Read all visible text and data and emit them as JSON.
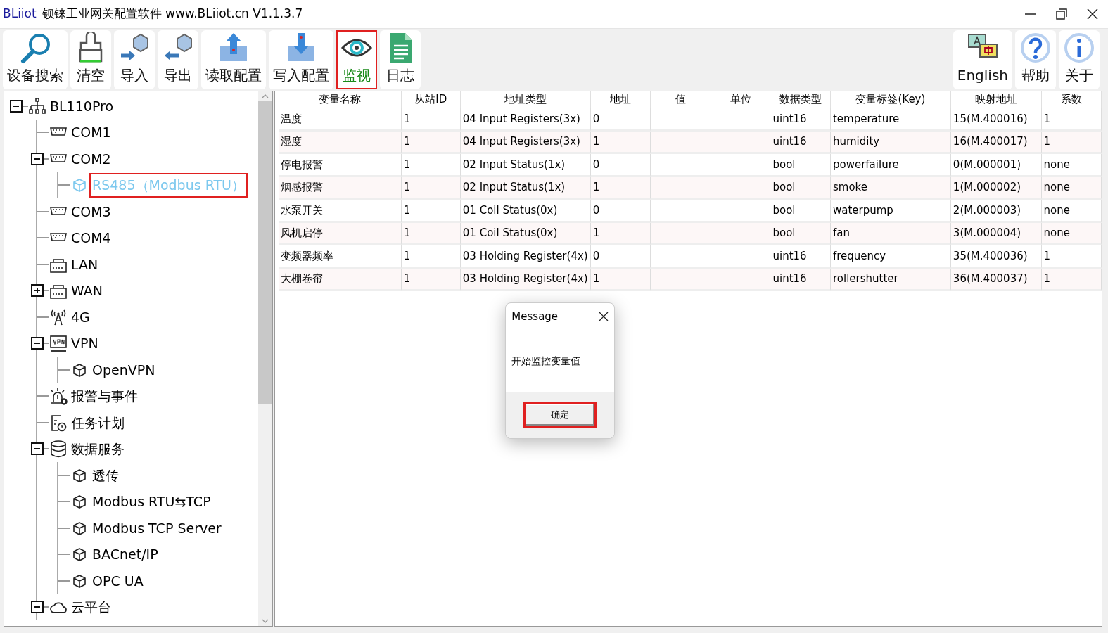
{
  "window": {
    "brand": "BLiiot",
    "title": "钡铼工业网关配置软件 www.BLiiot.cn V1.1.3.7"
  },
  "toolbar": [
    {
      "label": "设备搜索",
      "kind": "search",
      "highlighted": false
    },
    {
      "label": "清空",
      "kind": "brush",
      "highlighted": false
    },
    {
      "label": "导入",
      "kind": "import",
      "highlighted": false
    },
    {
      "label": "导出",
      "kind": "export",
      "highlighted": false
    },
    {
      "label": "读取配置",
      "kind": "read",
      "highlighted": false
    },
    {
      "label": "写入配置",
      "kind": "write",
      "highlighted": false
    },
    {
      "label": "监视",
      "kind": "eye",
      "highlighted": true
    },
    {
      "label": "日志",
      "kind": "log",
      "highlighted": false
    }
  ],
  "toolbar_right": [
    {
      "label": "English",
      "kind": "language"
    },
    {
      "label": "帮助",
      "kind": "help"
    },
    {
      "label": "关于",
      "kind": "about"
    }
  ],
  "tree": [
    {
      "label": "BL110Pro",
      "kind": "network",
      "expanded": true,
      "selected": false,
      "children": [
        {
          "label": "COM1",
          "kind": "serial",
          "selected": false
        },
        {
          "label": "COM2",
          "kind": "serial",
          "expanded": true,
          "selected": false,
          "children": [
            {
              "label": "RS485（Modbus RTU）",
              "kind": "cube",
              "selected": true
            }
          ]
        },
        {
          "label": "COM3",
          "kind": "serial",
          "selected": false
        },
        {
          "label": "COM4",
          "kind": "serial",
          "selected": false
        },
        {
          "label": "LAN",
          "kind": "ethernet",
          "selected": false
        },
        {
          "label": "WAN",
          "kind": "ethernet",
          "expanded": false,
          "selected": false
        },
        {
          "label": "4G",
          "kind": "antenna",
          "selected": false
        },
        {
          "label": "VPN",
          "kind": "vpn",
          "expanded": true,
          "selected": false,
          "children": [
            {
              "label": "OpenVPN",
              "kind": "cube",
              "selected": false
            }
          ]
        },
        {
          "label": "报警与事件",
          "kind": "alarm",
          "selected": false
        },
        {
          "label": "任务计划",
          "kind": "schedule",
          "selected": false
        },
        {
          "label": "数据服务",
          "kind": "database",
          "expanded": true,
          "selected": false,
          "children": [
            {
              "label": "透传",
              "kind": "cube",
              "selected": false
            },
            {
              "label": "Modbus RTU⇆TCP",
              "kind": "cube",
              "selected": false
            },
            {
              "label": "Modbus TCP Server",
              "kind": "cube",
              "selected": false
            },
            {
              "label": "BACnet/IP",
              "kind": "cube",
              "selected": false
            },
            {
              "label": "OPC UA",
              "kind": "cube",
              "selected": false
            }
          ]
        },
        {
          "label": "云平台",
          "kind": "cloud",
          "expanded": true,
          "selected": false
        }
      ]
    }
  ],
  "table": {
    "columns": [
      "变量名称",
      "从站ID",
      "地址类型",
      "地址",
      "值",
      "单位",
      "数据类型",
      "变量标签(Key)",
      "映射地址",
      "系数"
    ],
    "rows": [
      [
        "温度",
        "1",
        "04 Input Registers(3x)",
        "0",
        "",
        "",
        "uint16",
        "temperature",
        "15(M.400016)",
        "1"
      ],
      [
        "湿度",
        "1",
        "04 Input Registers(3x)",
        "1",
        "",
        "",
        "uint16",
        "humidity",
        "16(M.400017)",
        "1"
      ],
      [
        "停电报警",
        "1",
        "02 Input Status(1x)",
        "0",
        "",
        "",
        "bool",
        "powerfailure",
        "0(M.000001)",
        "none"
      ],
      [
        "烟感报警",
        "1",
        "02 Input Status(1x)",
        "1",
        "",
        "",
        "bool",
        "smoke",
        "1(M.000002)",
        "none"
      ],
      [
        "水泵开关",
        "1",
        "01 Coil Status(0x)",
        "0",
        "",
        "",
        "bool",
        "waterpump",
        "2(M.000003)",
        "none"
      ],
      [
        "风机启停",
        "1",
        "01 Coil Status(0x)",
        "1",
        "",
        "",
        "bool",
        "fan",
        "3(M.000004)",
        "none"
      ],
      [
        "变频器频率",
        "1",
        "03 Holding Register(4x)",
        "0",
        "",
        "",
        "uint16",
        "frequency",
        "35(M.400036)",
        "1"
      ],
      [
        "大棚卷帘",
        "1",
        "03 Holding Register(4x)",
        "1",
        "",
        "",
        "uint16",
        "rollershutter",
        "36(M.400037)",
        "1"
      ]
    ]
  },
  "dialog": {
    "title": "Message",
    "message": "开始监控变量值",
    "button": "确定",
    "button_highlighted": true
  }
}
